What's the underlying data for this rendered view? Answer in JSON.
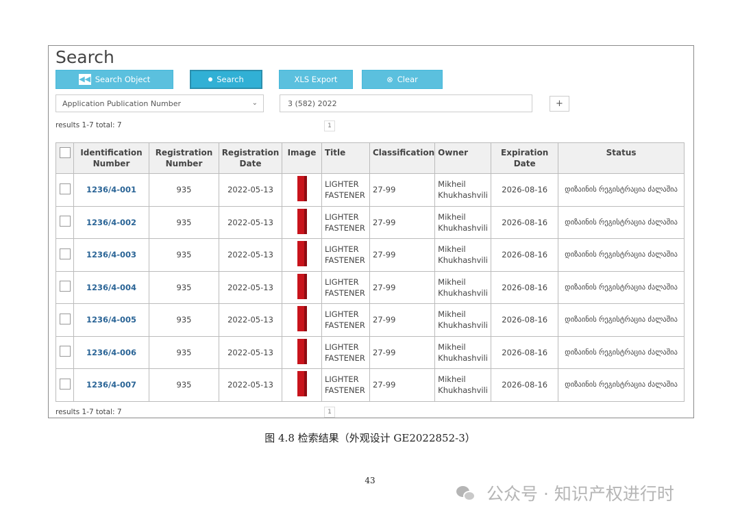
{
  "page": {
    "title": "Search",
    "buttons": {
      "search_object": "Search Object",
      "search": "Search",
      "xls_export": "XLS Export",
      "clear": "Clear"
    },
    "field_select": "Application Publication Number",
    "query_value": "3 (582) 2022",
    "plus_label": "+",
    "results_label": "results 1-7 total: 7",
    "page_number": "1"
  },
  "table": {
    "headers": {
      "id": "Identification Number",
      "reg": "Registration Number",
      "regdate": "Registration Date",
      "image": "Image",
      "title": "Title",
      "class": "Classification",
      "owner": "Owner",
      "exp": "Expiration Date",
      "status": "Status"
    },
    "rows": [
      {
        "id": "1236/4-001",
        "reg": "935",
        "regdate": "2022-05-13",
        "title_1": "LIGHTER",
        "title_2": "FASTENER",
        "class": "27-99",
        "owner_1": "Mikheil",
        "owner_2": "Khukhashvili",
        "exp": "2026-08-16",
        "status": "დიზაინის რეგისტრაცია ძალაშია"
      },
      {
        "id": "1236/4-002",
        "reg": "935",
        "regdate": "2022-05-13",
        "title_1": "LIGHTER",
        "title_2": "FASTENER",
        "class": "27-99",
        "owner_1": "Mikheil",
        "owner_2": "Khukhashvili",
        "exp": "2026-08-16",
        "status": "დიზაინის რეგისტრაცია ძალაშია"
      },
      {
        "id": "1236/4-003",
        "reg": "935",
        "regdate": "2022-05-13",
        "title_1": "LIGHTER",
        "title_2": "FASTENER",
        "class": "27-99",
        "owner_1": "Mikheil",
        "owner_2": "Khukhashvili",
        "exp": "2026-08-16",
        "status": "დიზაინის რეგისტრაცია ძალაშია"
      },
      {
        "id": "1236/4-004",
        "reg": "935",
        "regdate": "2022-05-13",
        "title_1": "LIGHTER",
        "title_2": "FASTENER",
        "class": "27-99",
        "owner_1": "Mikheil",
        "owner_2": "Khukhashvili",
        "exp": "2026-08-16",
        "status": "დიზაინის რეგისტრაცია ძალაშია"
      },
      {
        "id": "1236/4-005",
        "reg": "935",
        "regdate": "2022-05-13",
        "title_1": "LIGHTER",
        "title_2": "FASTENER",
        "class": "27-99",
        "owner_1": "Mikheil",
        "owner_2": "Khukhashvili",
        "exp": "2026-08-16",
        "status": "დიზაინის რეგისტრაცია ძალაშია"
      },
      {
        "id": "1236/4-006",
        "reg": "935",
        "regdate": "2022-05-13",
        "title_1": "LIGHTER",
        "title_2": "FASTENER",
        "class": "27-99",
        "owner_1": "Mikheil",
        "owner_2": "Khukhashvili",
        "exp": "2026-08-16",
        "status": "დიზაინის რეგისტრაცია ძალაშია"
      },
      {
        "id": "1236/4-007",
        "reg": "935",
        "regdate": "2022-05-13",
        "title_1": "LIGHTER",
        "title_2": "FASTENER",
        "class": "27-99",
        "owner_1": "Mikheil",
        "owner_2": "Khukhashvili",
        "exp": "2026-08-16",
        "status": "დიზაინის რეგისტრაცია ძალაშია"
      }
    ]
  },
  "caption": "图 4.8 检索结果（外观设计 GE2022852-3）",
  "page_number_footer": "43",
  "watermark": "公众号 · 知识产权进行时",
  "colors": {
    "button": "#5bc0de",
    "button_active": "#31b0d5",
    "link": "#2a6496",
    "thumbnail": "#c8141c"
  },
  "icons": [
    "rewind-icon",
    "search-dot-icon",
    "clear-icon",
    "chevron-down-icon",
    "plus-icon",
    "wechat-icon"
  ]
}
